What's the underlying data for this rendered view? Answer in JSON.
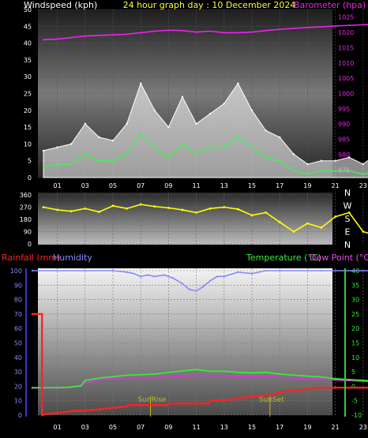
{
  "header": {
    "title": "24 hour graph day : 10 December 2024",
    "left_label": "Windspeed (kph)",
    "right_label": "Barometer (hpa)"
  },
  "colors": {
    "background": "#000000",
    "wind_axis": "#ffffff",
    "gust": "#ffffff",
    "avg_wind": "#44ee55",
    "barometer": "#ee22ee",
    "title": "#ffff33",
    "direction": "#ffff00",
    "rain": "#ff2222",
    "humidity": "#8888ff",
    "temperature": "#33ee33",
    "dewpoint": "#dd33dd",
    "temp_axis": "#33ee33",
    "sun_lines": "#bbbb22"
  },
  "x_ticks": [
    "01",
    "03",
    "05",
    "07",
    "09",
    "11",
    "13",
    "15",
    "17",
    "19",
    "21",
    "23"
  ],
  "chart_data": [
    {
      "type": "line",
      "name": "wind-barometer",
      "x_range": [
        0,
        24
      ],
      "ylabel": "Windspeed (kph)",
      "y2label": "Barometer (hpa)",
      "ylim": [
        0,
        50
      ],
      "y_ticks": [
        "0",
        "5",
        "10",
        "15",
        "20",
        "25",
        "30",
        "35",
        "40",
        "45",
        "50"
      ],
      "y2lim": [
        972.5,
        1027.5
      ],
      "y2_ticks": [
        "975",
        "980",
        "985",
        "990",
        "995",
        "1000",
        "1005",
        "1010",
        "1015",
        "1020",
        "1025"
      ],
      "series": [
        {
          "axis": "y2",
          "style": "line",
          "x": [
            0,
            1,
            2,
            3,
            4,
            5,
            6,
            7,
            8,
            9,
            10,
            11,
            12,
            13,
            14,
            15,
            16,
            17,
            18,
            19,
            20,
            21,
            22,
            23,
            24
          ],
          "values": [
            1017.6,
            1017.8,
            1018.3,
            1018.8,
            1019.0,
            1019.2,
            1019.4,
            1019.9,
            1020.4,
            1020.7,
            1020.6,
            1020.1,
            1020.4,
            1019.9,
            1019.9,
            1020.1,
            1020.6,
            1021.0,
            1021.3,
            1021.6,
            1021.8,
            1022.1,
            1022.3,
            1022.5,
            1022.8
          ]
        },
        {
          "style": "fill-line",
          "x": [
            0,
            1,
            2,
            3,
            4,
            5,
            6,
            7,
            8,
            9,
            10,
            11,
            12,
            13,
            14,
            15,
            16,
            17,
            18,
            19,
            20,
            21,
            22,
            23,
            24
          ],
          "values": [
            8,
            9,
            10,
            16,
            12,
            11,
            16,
            28,
            20,
            15,
            24,
            16,
            19,
            22,
            28,
            20,
            14,
            12,
            7,
            4,
            5,
            5,
            6,
            4,
            7
          ]
        },
        {
          "style": "line",
          "x": [
            0,
            1,
            2,
            3,
            4,
            5,
            6,
            7,
            8,
            9,
            10,
            11,
            12,
            13,
            14,
            15,
            16,
            17,
            18,
            19,
            20,
            21,
            22,
            23,
            24
          ],
          "values": [
            3,
            4,
            4,
            7,
            5,
            5,
            7,
            13,
            9,
            6,
            10,
            7,
            9,
            9,
            12,
            9,
            6,
            5,
            2,
            1,
            2,
            2,
            2,
            1,
            2
          ]
        }
      ]
    },
    {
      "type": "line",
      "name": "wind-direction",
      "x_range": [
        0,
        24
      ],
      "ylim": [
        0,
        360
      ],
      "y_ticks": [
        "0",
        "90",
        "180",
        "270",
        "360"
      ],
      "compass": [
        "N",
        "W",
        "S",
        "E",
        "N"
      ],
      "series": [
        {
          "x": [
            0,
            1,
            2,
            3,
            4,
            5,
            6,
            7,
            8,
            9,
            10,
            11,
            12,
            13,
            14,
            15,
            16,
            17,
            18,
            19,
            20,
            21,
            22,
            23,
            24
          ],
          "values": [
            270,
            250,
            240,
            260,
            235,
            280,
            260,
            290,
            275,
            265,
            250,
            230,
            260,
            270,
            255,
            210,
            230,
            160,
            90,
            150,
            120,
            200,
            230,
            90,
            60
          ]
        }
      ]
    },
    {
      "type": "line",
      "name": "rain-humidity-temperature",
      "x_range": [
        0,
        24
      ],
      "ylabel": "Rainfall (mm)",
      "ylabel2": "Humidity",
      "y2label": "Temperature (°C)",
      "y2label2": "Dew Point (°C)",
      "ylim": [
        0,
        100
      ],
      "y_ticks": [
        "0",
        "10",
        "20",
        "30",
        "40",
        "50",
        "60",
        "70",
        "80",
        "90",
        "100"
      ],
      "y2lim": [
        -10,
        40
      ],
      "y2_ticks": [
        "-10",
        "-5",
        "0",
        "5",
        "10",
        "15",
        "20",
        "25",
        "30",
        "35",
        "40"
      ],
      "annotations": [
        {
          "x": 7.7,
          "label": "SunRise"
        },
        {
          "x": 16.3,
          "label": "SunSet"
        }
      ],
      "series": [
        {
          "axis": "y",
          "name": "Rainfall",
          "x": [
            -0.8,
            -0.1,
            -0.1,
            0.3,
            1.5,
            2.2,
            2.8,
            4.0,
            6.0,
            6.1,
            9.0,
            9.1,
            10.0,
            11.9,
            12.0,
            13.9,
            14.0,
            16.5,
            17.0,
            18.0,
            19.0,
            19.5,
            20.0,
            21.0,
            24.0,
            24.0
          ],
          "values": [
            70,
            70,
            0,
            1,
            2,
            3,
            3,
            4,
            6,
            7,
            7,
            8,
            8,
            8,
            10,
            11,
            12,
            14,
            16,
            17,
            18,
            19,
            19,
            19,
            19,
            0
          ]
        },
        {
          "axis": "y",
          "name": "Humidity",
          "x": [
            -0.8,
            5,
            6,
            6.5,
            7,
            7.5,
            8,
            8.7,
            9.3,
            10,
            10.5,
            11,
            11.5,
            12,
            12.5,
            13,
            14,
            15,
            16,
            20,
            24
          ],
          "values": [
            100,
            100,
            99,
            98,
            96,
            97,
            96,
            97,
            95,
            91,
            87,
            86,
            89,
            93,
            96,
            96,
            99,
            98,
            100,
            100,
            100
          ]
        },
        {
          "axis": "y2",
          "name": "Temperature",
          "x": [
            -0.8,
            1,
            2,
            2.7,
            3,
            4,
            5,
            6,
            7,
            8,
            9,
            10,
            11,
            12,
            13,
            14,
            15,
            16,
            17,
            18,
            19,
            20,
            21,
            22,
            23,
            24
          ],
          "values": [
            -0.5,
            -0.5,
            -0.3,
            0.2,
            2.0,
            2.8,
            3.3,
            3.8,
            4.0,
            4.2,
            4.8,
            5.3,
            5.8,
            5.2,
            5.2,
            4.8,
            4.6,
            4.8,
            4.2,
            3.8,
            3.5,
            3.2,
            2.6,
            2.3,
            2.0,
            1.8
          ]
        },
        {
          "axis": "y2",
          "name": "Dew Point",
          "x": [
            -0.8,
            1,
            2,
            2.7,
            3,
            4,
            5,
            6,
            7,
            8,
            9,
            10,
            11,
            12,
            13,
            14,
            15,
            16,
            17,
            18,
            19,
            20,
            21,
            22,
            23,
            24
          ],
          "values": [
            -0.6,
            -0.6,
            -0.4,
            0,
            1.2,
            2.2,
            2.7,
            2.9,
            3.0,
            3.0,
            3.2,
            3.5,
            3.8,
            3.7,
            3.6,
            3.4,
            3.3,
            3.3,
            3.1,
            2.8,
            2.7,
            2.5,
            2.2,
            2.0,
            1.8,
            1.6
          ]
        }
      ]
    }
  ]
}
